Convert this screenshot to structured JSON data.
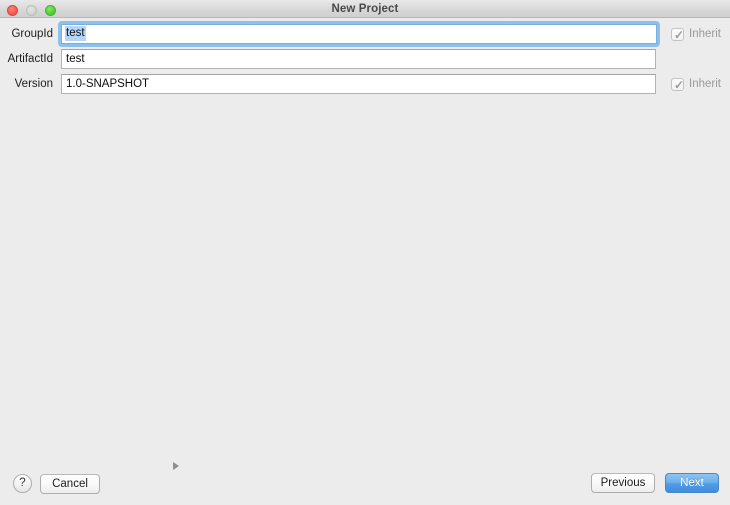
{
  "window": {
    "title": "New Project",
    "traffic_lights": [
      {
        "name": "close",
        "color": "#f65f55",
        "enabled": true
      },
      {
        "name": "minimize",
        "color": "#d6d6d6",
        "enabled": false
      },
      {
        "name": "zoom",
        "color": "#54d236",
        "enabled": true
      }
    ],
    "background_color": "#ececec"
  },
  "form": {
    "rows": [
      {
        "label": "GroupId",
        "value": "test",
        "placeholder": "",
        "focused": true,
        "selected": true,
        "inherit": {
          "label": "Inherit",
          "checked": true,
          "enabled": false
        }
      },
      {
        "label": "ArtifactId",
        "value": "test",
        "placeholder": "",
        "focused": false,
        "selected": false,
        "inherit": null
      },
      {
        "label": "Version",
        "value": "1.0-SNAPSHOT",
        "placeholder": "",
        "focused": false,
        "selected": false,
        "inherit": {
          "label": "Inherit",
          "checked": true,
          "enabled": false
        }
      }
    ]
  },
  "footer": {
    "help_label": "?",
    "cancel_label": "Cancel",
    "previous_label": "Previous",
    "next_label": "Next",
    "disclosure_icon": "triangle-right-icon",
    "default_button": "Next",
    "accent_color": "#4f9ce6"
  }
}
